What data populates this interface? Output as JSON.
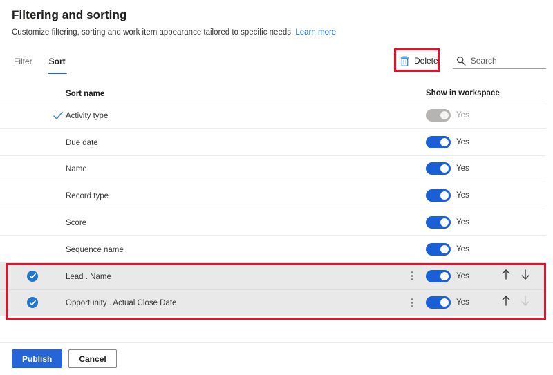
{
  "header": {
    "title": "Filtering and sorting",
    "subtitle": "Customize filtering, sorting and work item appearance tailored to specific needs.",
    "learn_more": "Learn more"
  },
  "tabs": [
    {
      "label": "Filter",
      "active": false
    },
    {
      "label": "Sort",
      "active": true
    }
  ],
  "commandbar": {
    "delete_label": "Delete",
    "delete_icon": "trash-icon",
    "search_icon": "search-icon",
    "search_placeholder": "Search",
    "search_value": ""
  },
  "table": {
    "columns": {
      "sort_name": "Sort name",
      "show_in_workspace": "Show in workspace"
    },
    "rows": [
      {
        "name": "Activity type",
        "mark": "check",
        "selected": false,
        "kebab": false,
        "toggle": "Yes",
        "toggle_on": true,
        "toggle_disabled": true,
        "arrows": null
      },
      {
        "name": "Due date",
        "mark": "none",
        "selected": false,
        "kebab": false,
        "toggle": "Yes",
        "toggle_on": true,
        "toggle_disabled": false,
        "arrows": null
      },
      {
        "name": "Name",
        "mark": "none",
        "selected": false,
        "kebab": false,
        "toggle": "Yes",
        "toggle_on": true,
        "toggle_disabled": false,
        "arrows": null
      },
      {
        "name": "Record type",
        "mark": "none",
        "selected": false,
        "kebab": false,
        "toggle": "Yes",
        "toggle_on": true,
        "toggle_disabled": false,
        "arrows": null
      },
      {
        "name": "Score",
        "mark": "none",
        "selected": false,
        "kebab": false,
        "toggle": "Yes",
        "toggle_on": true,
        "toggle_disabled": false,
        "arrows": null
      },
      {
        "name": "Sequence name",
        "mark": "none",
        "selected": false,
        "kebab": false,
        "toggle": "Yes",
        "toggle_on": true,
        "toggle_disabled": false,
        "arrows": null
      },
      {
        "name": "Lead . Name",
        "mark": "circle",
        "selected": true,
        "kebab": true,
        "toggle": "Yes",
        "toggle_on": true,
        "toggle_disabled": false,
        "arrows": {
          "up": "enabled",
          "down": "enabled"
        }
      },
      {
        "name": "Opportunity . Actual Close Date",
        "mark": "circle",
        "selected": true,
        "kebab": true,
        "toggle": "Yes",
        "toggle_on": true,
        "toggle_disabled": false,
        "arrows": {
          "up": "enabled",
          "down": "disabled"
        }
      }
    ]
  },
  "footer": {
    "publish_label": "Publish",
    "cancel_label": "Cancel"
  },
  "colors": {
    "accent_blue": "#2565d8",
    "toggle_on": "#1a5fd6",
    "toggle_disabled": "#b6b4b2",
    "link_blue": "#1b6ec2",
    "annotation_red": "#e8112d",
    "selected_row_bg": "#e9e9e9",
    "divider": "#edebe9"
  }
}
